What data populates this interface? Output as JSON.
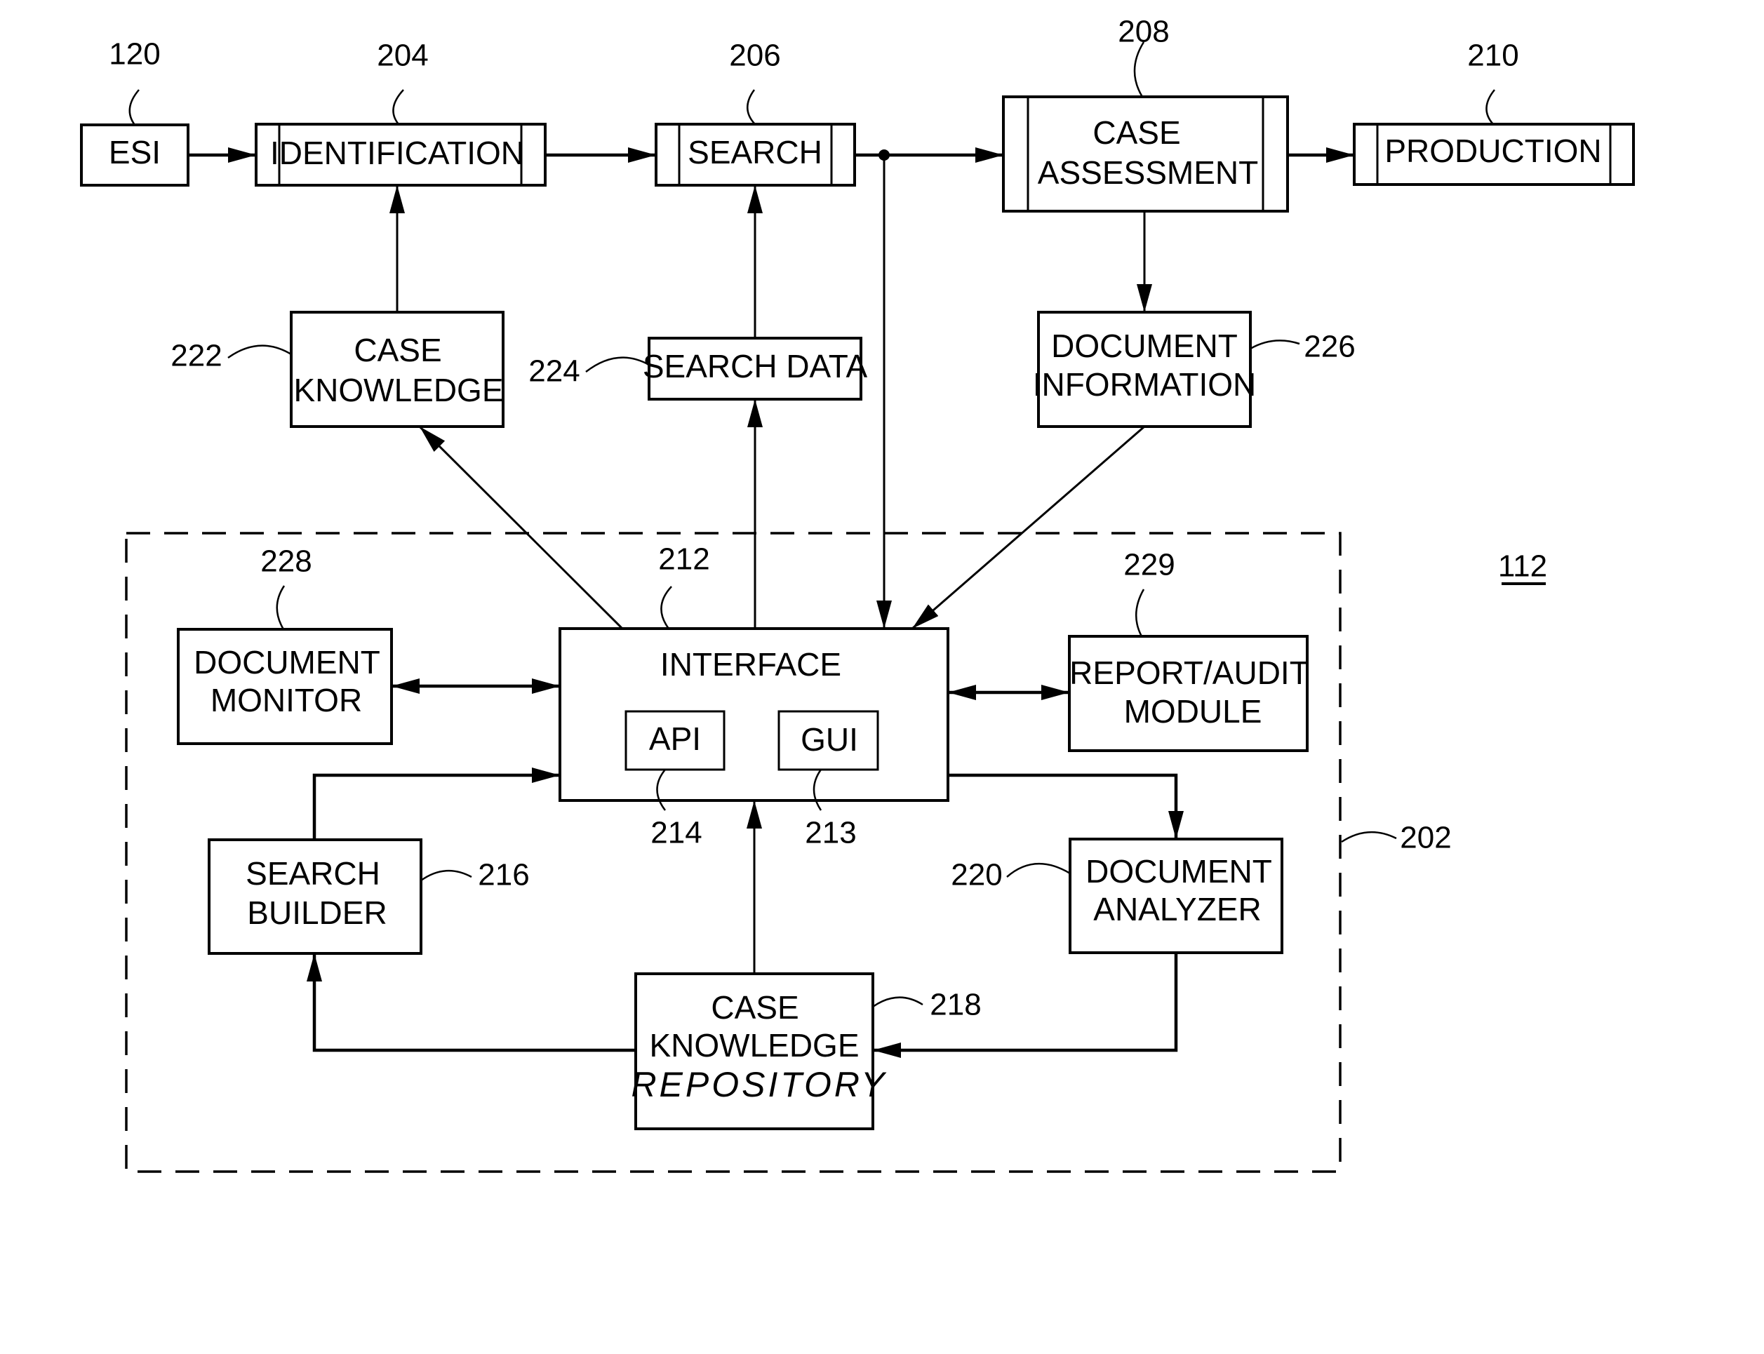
{
  "figure": {
    "system_ref": "112",
    "system_boundary_ref": "202"
  },
  "process_blocks": [
    {
      "id": "esi",
      "label_lines": [
        "ESI"
      ],
      "ref": "120",
      "style": "plain"
    },
    {
      "id": "identification",
      "label_lines": [
        "IDENTIFICATION"
      ],
      "ref": "204",
      "style": "predefined-process"
    },
    {
      "id": "search",
      "label_lines": [
        "SEARCH"
      ],
      "ref": "206",
      "style": "predefined-process"
    },
    {
      "id": "case-assessment",
      "label_lines": [
        "CASE",
        "ASSESSMENT"
      ],
      "ref": "208",
      "style": "predefined-process"
    },
    {
      "id": "production",
      "label_lines": [
        "PRODUCTION"
      ],
      "ref": "210",
      "style": "predefined-process"
    }
  ],
  "data_blocks": [
    {
      "id": "case-knowledge",
      "label_lines": [
        "CASE",
        "KNOWLEDGE"
      ],
      "ref": "222"
    },
    {
      "id": "search-data",
      "label_lines": [
        "SEARCH DATA"
      ],
      "ref": "224"
    },
    {
      "id": "document-information",
      "label_lines": [
        "DOCUMENT",
        "INFORMATION"
      ],
      "ref": "226"
    }
  ],
  "modules": [
    {
      "id": "document-monitor",
      "label_lines": [
        "DOCUMENT",
        "MONITOR"
      ],
      "ref": "228"
    },
    {
      "id": "interface",
      "label_lines": [
        "INTERFACE"
      ],
      "ref": "212"
    },
    {
      "id": "api",
      "label_lines": [
        "API"
      ],
      "ref": "214"
    },
    {
      "id": "gui",
      "label_lines": [
        "GUI"
      ],
      "ref": "213"
    },
    {
      "id": "report-audit-module",
      "label_lines": [
        "REPORT/AUDIT",
        "MODULE"
      ],
      "ref": "229"
    },
    {
      "id": "search-builder",
      "label_lines": [
        "SEARCH",
        "BUILDER"
      ],
      "ref": "216"
    },
    {
      "id": "document-analyzer",
      "label_lines": [
        "DOCUMENT",
        "ANALYZER"
      ],
      "ref": "220"
    },
    {
      "id": "case-knowledge-repository",
      "label_lines": [
        "CASE",
        "KNOWLEDGE"
      ],
      "handwritten_line": "REPOSITORY",
      "ref": "218"
    }
  ],
  "connections": [
    {
      "from": "esi",
      "to": "identification",
      "type": "arrow"
    },
    {
      "from": "identification",
      "to": "search",
      "type": "arrow"
    },
    {
      "from": "search",
      "to": "case-assessment",
      "type": "arrow"
    },
    {
      "from": "search",
      "to": "interface",
      "type": "arrow",
      "via": "junction"
    },
    {
      "from": "case-assessment",
      "to": "production",
      "type": "arrow"
    },
    {
      "from": "case-assessment",
      "to": "document-information",
      "type": "arrow"
    },
    {
      "from": "case-knowledge",
      "to": "identification",
      "type": "arrow"
    },
    {
      "from": "search-data",
      "to": "search",
      "type": "arrow"
    },
    {
      "from": "interface",
      "to": "case-knowledge",
      "type": "arrow"
    },
    {
      "from": "interface",
      "to": "search-data",
      "type": "arrow"
    },
    {
      "from": "document-information",
      "to": "interface",
      "type": "arrow"
    },
    {
      "from": "document-monitor",
      "to": "interface",
      "type": "bidirectional"
    },
    {
      "from": "interface",
      "to": "report-audit-module",
      "type": "bidirectional"
    },
    {
      "from": "search-builder",
      "to": "interface",
      "type": "arrow"
    },
    {
      "from": "interface",
      "to": "document-analyzer",
      "type": "arrow"
    },
    {
      "from": "case-knowledge-repository",
      "to": "interface",
      "type": "arrow"
    },
    {
      "from": "case-knowledge-repository",
      "to": "search-builder",
      "type": "arrow"
    },
    {
      "from": "document-analyzer",
      "to": "case-knowledge-repository",
      "type": "arrow"
    }
  ]
}
